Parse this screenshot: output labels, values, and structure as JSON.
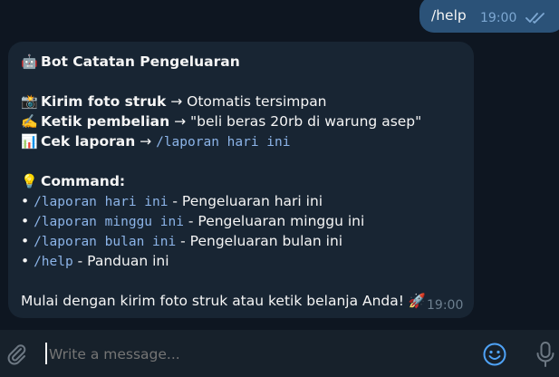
{
  "outgoing": {
    "text": "/help",
    "time": "19:00",
    "status_icon": "double-check-icon"
  },
  "incoming": {
    "title_emoji": "🤖",
    "title": "Bot Catatan Pengeluaran",
    "feature_1": {
      "emoji": "📸",
      "label": "Kirim foto struk",
      "rest": " → Otomatis tersimpan"
    },
    "feature_2": {
      "emoji": "✍️",
      "label": "Ketik pembelian",
      "rest": " → \"beli beras 20rb di warung asep\""
    },
    "feature_3": {
      "emoji": "📊",
      "label": "Cek laporan",
      "arrow": " → ",
      "cmd": "/laporan hari ini"
    },
    "command_header": {
      "emoji": "💡",
      "label": "Command:"
    },
    "commands": [
      {
        "bullet": "• ",
        "cmd": "/laporan hari ini",
        "desc": " - Pengeluaran hari ini"
      },
      {
        "bullet": "• ",
        "cmd": "/laporan minggu ini",
        "desc": " - Pengeluaran minggu ini"
      },
      {
        "bullet": "• ",
        "cmd": "/laporan bulan ini",
        "desc": " - Pengeluaran bulan ini"
      },
      {
        "bullet": "• ",
        "cmd": "/help",
        "desc": " - Panduan ini"
      }
    ],
    "footer": "Mulai dengan kirim foto struk atau ketik belanja Anda!",
    "footer_emoji": "🚀",
    "time": "19:00"
  },
  "composer": {
    "placeholder": "Write a message...",
    "attach_icon": "paperclip-icon",
    "emoji_icon": "smiley-icon",
    "mic_icon": "microphone-icon"
  },
  "colors": {
    "background": "#0e1621",
    "outgoing_bubble": "#2b5278",
    "incoming_bubble": "#182533",
    "command_link": "#8cb4e8",
    "composer": "#17212b"
  }
}
